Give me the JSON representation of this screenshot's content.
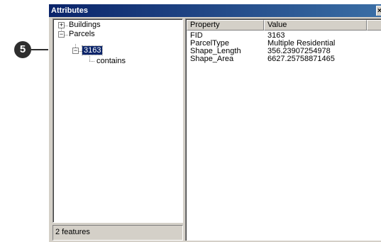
{
  "window": {
    "title": "Attributes",
    "close_label": "×"
  },
  "tree": {
    "nodes": [
      {
        "label": "Buildings",
        "expander": "+"
      },
      {
        "label": "Parcels",
        "expander": "−"
      },
      {
        "label": "3163",
        "expander": "−",
        "selected": true
      },
      {
        "label": "contains"
      }
    ]
  },
  "status": {
    "text": "2 features"
  },
  "properties": {
    "headers": [
      "Property",
      "Value"
    ],
    "rows": [
      {
        "property": "FID",
        "value": "3163"
      },
      {
        "property": "ParcelType",
        "value": "Multiple Residential"
      },
      {
        "property": "Shape_Length",
        "value": "356.23907254978"
      },
      {
        "property": "Shape_Area",
        "value": "6627.25758871465"
      }
    ]
  },
  "callout": {
    "number": "5"
  },
  "colors": {
    "title_start": "#0a246a",
    "title_end": "#3a6ea5",
    "selection": "#0a246a",
    "chrome": "#d4d0c8"
  }
}
